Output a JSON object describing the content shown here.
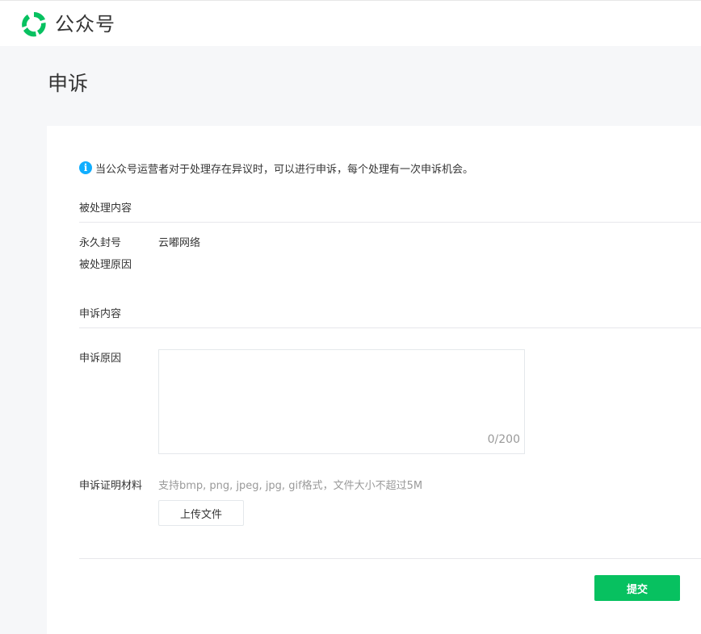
{
  "header": {
    "logo_icon": "wechat-official-accounts-logo-icon",
    "brand": "公众号",
    "accent_color": "#07c160"
  },
  "page": {
    "title": "申诉"
  },
  "notice": {
    "icon": "info-icon",
    "icon_glyph": "i",
    "text": "当公众号运营者对于处理存在异议时，可以进行申诉，每个处理有一次申诉机会。"
  },
  "processed": {
    "section_title": "被处理内容",
    "type_label": "永久封号",
    "type_value": "云嘟网络",
    "reason_label": "被处理原因"
  },
  "appeal": {
    "section_title": "申诉内容",
    "reason_label": "申诉原因",
    "reason_value": "",
    "counter": "0/200",
    "evidence_label": "申诉证明材料",
    "evidence_hint": "支持bmp, png, jpeg, jpg, gif格式，文件大小不超过5M",
    "upload_label": "上传文件"
  },
  "footer": {
    "submit_label": "提交"
  }
}
